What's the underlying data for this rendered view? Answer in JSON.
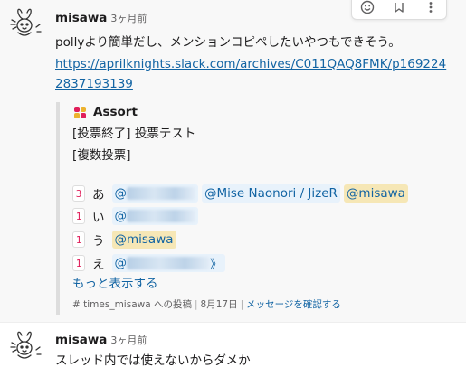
{
  "messages": [
    {
      "author": "misawa",
      "time": "3ヶ月前",
      "text": "pollyより簡単だし、メンションコピペしたいやつもできそう。",
      "link": "https://aprilknights.slack.com/archives/C011QAQ8FMK/p1692242837193139",
      "attachment": {
        "app_name": "Assort",
        "line1": "[投票終了] 投票テスト",
        "line2": "[複数投票]",
        "votes": [
          {
            "count": "3",
            "option": "あ",
            "mentions": [
              "@",
              "@Mise Naonori / JizeR",
              "@misawa"
            ]
          },
          {
            "count": "1",
            "option": "い",
            "mentions": [
              "@"
            ]
          },
          {
            "count": "1",
            "option": "う",
            "mentions": [
              "@misawa"
            ]
          },
          {
            "count": "1",
            "option": "え",
            "mentions": [
              "@",
              "》"
            ]
          }
        ],
        "show_more": "もっと表示する",
        "footer": {
          "channel": "# times_misawa への投稿",
          "date": "8月17日",
          "action": "メッセージを確認する"
        }
      }
    },
    {
      "author": "misawa",
      "time": "3ヶ月前",
      "text": "スレッド内では使えないからダメか"
    }
  ],
  "toolbar": {
    "icons": [
      "emoji-reaction-icon",
      "reply-thread-icon",
      "more-actions-icon"
    ]
  },
  "colors": {
    "link": "#1264a3",
    "count": "#e01e5a",
    "mention_bg": "#e8f2fb",
    "self_mention_bg": "#f6e7b6",
    "attachment_bar": "#dddddd"
  }
}
